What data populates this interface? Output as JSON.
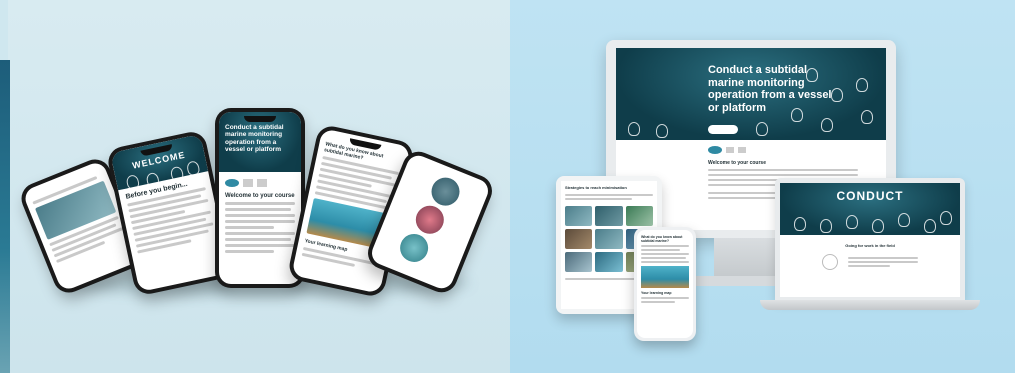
{
  "course": {
    "title": "Conduct a subtidal marine monitoring operation from a vessel or platform",
    "hero_button": "",
    "welcome_heading": "Welcome to your course",
    "before_heading": "Before you begin...",
    "welcome_banner": "WELCOME",
    "conduct_banner": "CONDUCT",
    "about_heading": "What do you know about subtidal marine?",
    "field_heading": "Going for work in the field",
    "learning_map_heading": "Your learning map",
    "resources_heading": "Strategies to reach minimisation"
  },
  "colors": {
    "hero_dark": "#0f3d4a",
    "hero_mid": "#2b6f80",
    "left_bg": "#d3e8ef",
    "right_bg": "#b8dff1"
  },
  "icons": [
    "shell-icon",
    "logo-icon"
  ]
}
